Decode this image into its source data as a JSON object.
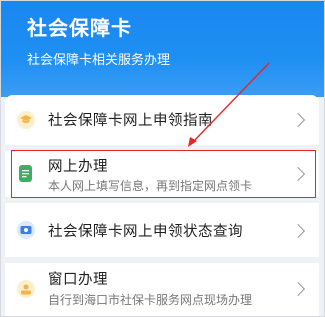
{
  "header": {
    "title": "社会保障卡",
    "subtitle": "社会保障卡相关服务办理"
  },
  "items": [
    {
      "title": "社会保障卡网上申领指南",
      "icon": "graduation-cap-icon",
      "icon_color": "#f2b54a"
    },
    {
      "title": "网上办理",
      "description": "本人网上填写信息，再到指定网点领卡",
      "icon": "document-icon",
      "icon_color": "#3fae62"
    },
    {
      "title": "社会保障卡网上申领状态查询",
      "icon": "id-card-icon",
      "icon_color": "#3d7ee8"
    },
    {
      "title": "窗口办理",
      "description": "自行到海口市社保卡服务网点现场办理",
      "icon": "service-window-icon",
      "icon_color": "#f2b54a"
    }
  ],
  "colors": {
    "header_blue": "#1e8ff3",
    "annotation_red": "#e02828"
  }
}
